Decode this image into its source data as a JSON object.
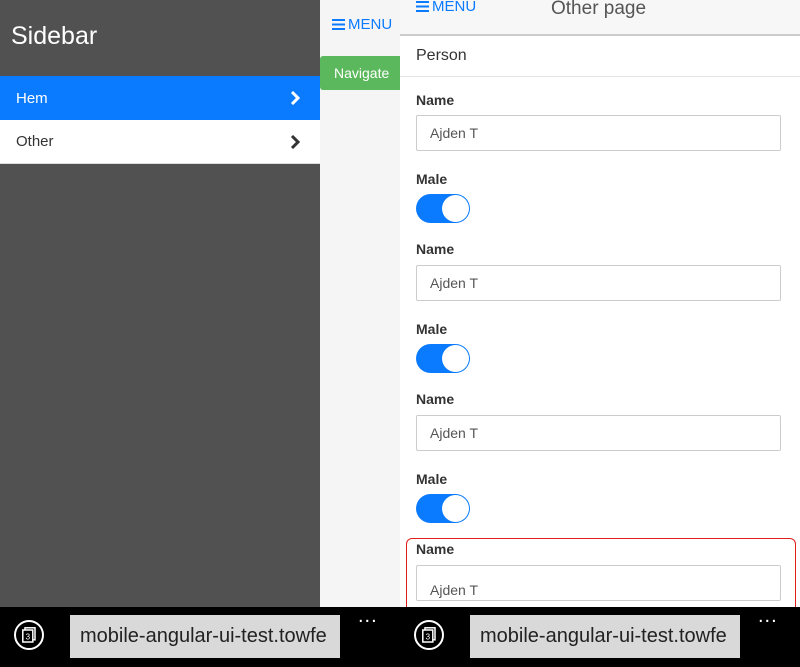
{
  "left_pane": {
    "sidebar": {
      "title": "Sidebar",
      "items": [
        {
          "label": "Hem",
          "active": true
        },
        {
          "label": "Other",
          "active": false
        }
      ]
    },
    "menu_label": "MENU",
    "navigate_label": "Navigate"
  },
  "right_pane": {
    "menu_label": "MENU",
    "title": "Other page",
    "section_title": "Person",
    "fields": [
      {
        "name_label": "Name",
        "name_value": "Ajden T",
        "male_label": "Male",
        "male_on": true
      },
      {
        "name_label": "Name",
        "name_value": "Ajden T",
        "male_label": "Male",
        "male_on": true
      },
      {
        "name_label": "Name",
        "name_value": "Ajden T",
        "male_label": "Male",
        "male_on": true
      },
      {
        "name_label": "Name",
        "name_value": "Ajden T"
      }
    ]
  },
  "browser_bar": {
    "url": "mobile-angular-ui-test.towfe",
    "tab_count": "3",
    "more": "..."
  },
  "colors": {
    "accent": "#0a7bff",
    "sidebar_bg": "#515151",
    "navigate_bg": "#5cb85c",
    "highlight": "#e0201b"
  }
}
